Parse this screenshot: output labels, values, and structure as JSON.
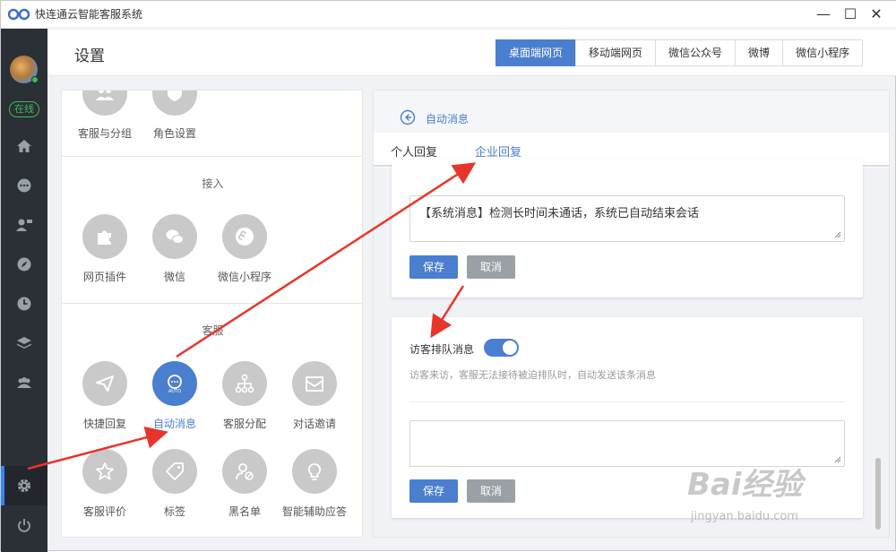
{
  "window": {
    "title": "快连通云智能客服系统",
    "minimize": "—",
    "maximize": "☐",
    "close": "✕"
  },
  "sidebar": {
    "status": "在线",
    "icons": [
      "home-icon",
      "chat-icon",
      "contacts-icon",
      "compass-icon",
      "history-icon",
      "layers-icon",
      "team-icon",
      "settings-icon",
      "power-icon"
    ]
  },
  "header": {
    "title": "设置",
    "tabs": [
      "桌面端网页",
      "移动端网页",
      "微信公众号",
      "微博",
      "微信小程序"
    ],
    "active_tab": "桌面端网页"
  },
  "left_panel": {
    "top_items": [
      "客服与分组",
      "角色设置"
    ],
    "access": {
      "title": "接入",
      "items": [
        "网页插件",
        "微信",
        "微信小程序"
      ]
    },
    "service": {
      "title": "客服",
      "items": [
        "快捷回复",
        "自动消息",
        "客服分配",
        "对话邀请",
        "客服评价",
        "标签",
        "黑名单",
        "智能辅助应答"
      ],
      "active": "自动消息"
    }
  },
  "right_panel": {
    "breadcrumb": "自动消息",
    "sub_tabs": [
      "个人回复",
      "企业回复"
    ],
    "active_sub_tab": "企业回复",
    "card1": {
      "message": "【系统消息】检测长时间未通话，系统已自动结束会话",
      "save": "保存",
      "cancel": "取消"
    },
    "card2": {
      "label": "访客排队消息",
      "toggle_on": true,
      "hint": "访客来访，客服无法接待被迫排队时，自动发送该条消息",
      "message": "",
      "save": "保存",
      "cancel": "取消"
    }
  },
  "watermark": {
    "text": "Bai经验",
    "url": "jingyan.baidu.com"
  },
  "colors": {
    "accent": "#4a7ecf",
    "sidebar_bg": "#2b2f36",
    "online": "#3dbb55",
    "arrow": "#e8352b"
  }
}
